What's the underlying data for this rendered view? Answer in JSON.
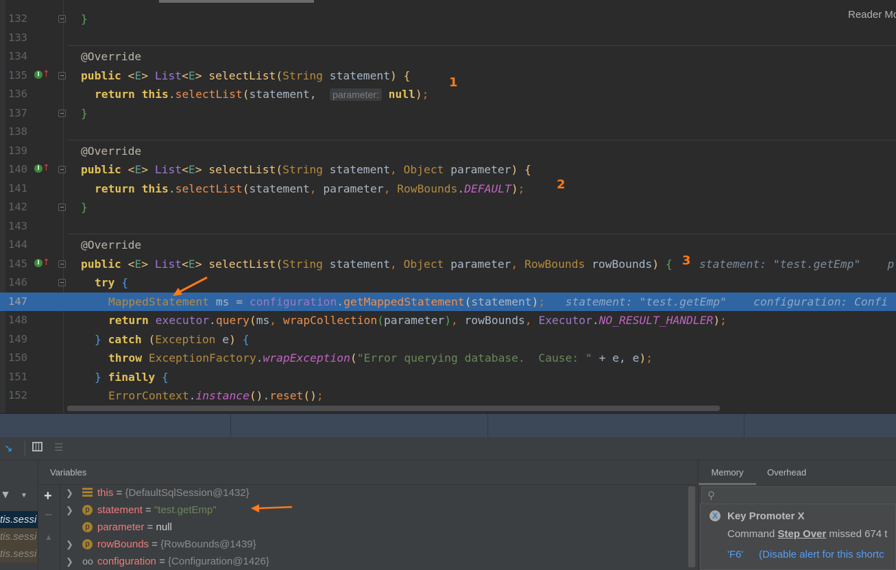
{
  "editor": {
    "reader_mode": "Reader Mode",
    "annotations": [
      "1",
      "2",
      "3"
    ],
    "lines": [
      {
        "n": "132",
        "indent": 0,
        "tokens": [
          [
            "}",
            "br"
          ]
        ]
      },
      {
        "n": "133",
        "indent": 0,
        "tokens": []
      },
      {
        "n": "134",
        "indent": 0,
        "tokens": [
          [
            "@Override",
            "ann"
          ]
        ]
      },
      {
        "n": "135",
        "indent": 0,
        "gutter": true,
        "tokens": [
          [
            "public ",
            "kw"
          ],
          [
            "<",
            "mt"
          ],
          [
            "E",
            "gen"
          ],
          [
            "> ",
            "mt"
          ],
          [
            "List",
            "lst"
          ],
          [
            "<",
            "mt"
          ],
          [
            "E",
            "gen"
          ],
          [
            "> ",
            "mt"
          ],
          [
            "selectList",
            "mt"
          ],
          [
            "(",
            "mt"
          ],
          [
            "String ",
            "ty"
          ],
          [
            "statement",
            "nm"
          ],
          [
            ") ",
            "mt"
          ],
          [
            "{",
            "mt"
          ]
        ]
      },
      {
        "n": "136",
        "indent": 1,
        "tokens": [
          [
            "return ",
            "kw"
          ],
          [
            "this",
            "kw"
          ],
          [
            ".",
            "nm"
          ],
          [
            "selectList",
            "mo"
          ],
          [
            "(",
            "mt"
          ],
          [
            "statement, ",
            "nm"
          ],
          [
            "hint:parameter:",
            "hint"
          ],
          [
            " null",
            "kw"
          ],
          [
            ")",
            "mt"
          ],
          [
            ";",
            "pu"
          ]
        ]
      },
      {
        "n": "137",
        "indent": 0,
        "tokens": [
          [
            "}",
            "br"
          ]
        ]
      },
      {
        "n": "138",
        "indent": 0,
        "tokens": []
      },
      {
        "n": "139",
        "indent": 0,
        "tokens": [
          [
            "@Override",
            "ann"
          ]
        ]
      },
      {
        "n": "140",
        "indent": 0,
        "gutter": true,
        "tokens": [
          [
            "public ",
            "kw"
          ],
          [
            "<",
            "mt"
          ],
          [
            "E",
            "gen"
          ],
          [
            "> ",
            "mt"
          ],
          [
            "List",
            "lst"
          ],
          [
            "<",
            "mt"
          ],
          [
            "E",
            "gen"
          ],
          [
            "> ",
            "mt"
          ],
          [
            "selectList",
            "mt"
          ],
          [
            "(",
            "mt"
          ],
          [
            "String ",
            "ty"
          ],
          [
            "statement",
            "nm"
          ],
          [
            ", ",
            "pu"
          ],
          [
            "Object ",
            "ty"
          ],
          [
            "parameter",
            "nm"
          ],
          [
            ") ",
            "mt"
          ],
          [
            "{",
            "mt"
          ]
        ]
      },
      {
        "n": "141",
        "indent": 1,
        "tokens": [
          [
            "return ",
            "kw"
          ],
          [
            "this",
            "kw"
          ],
          [
            ".",
            "nm"
          ],
          [
            "selectList",
            "mo"
          ],
          [
            "(",
            "mt"
          ],
          [
            "statement",
            "nm"
          ],
          [
            ", ",
            "pu"
          ],
          [
            "parameter",
            "nm"
          ],
          [
            ", ",
            "pu"
          ],
          [
            "RowBounds",
            "ty"
          ],
          [
            ".",
            "nm"
          ],
          [
            "DEFAULT",
            "it"
          ],
          [
            ")",
            "mt"
          ],
          [
            ";",
            "pu"
          ]
        ]
      },
      {
        "n": "142",
        "indent": 0,
        "tokens": [
          [
            "}",
            "br"
          ]
        ]
      },
      {
        "n": "143",
        "indent": 0,
        "tokens": []
      },
      {
        "n": "144",
        "indent": 0,
        "tokens": [
          [
            "@Override",
            "ann"
          ]
        ]
      },
      {
        "n": "145",
        "indent": 0,
        "gutter": true,
        "tokens": [
          [
            "public ",
            "kw"
          ],
          [
            "<",
            "mt"
          ],
          [
            "E",
            "gen"
          ],
          [
            "> ",
            "mt"
          ],
          [
            "List",
            "lst"
          ],
          [
            "<",
            "mt"
          ],
          [
            "E",
            "gen"
          ],
          [
            "> ",
            "mt"
          ],
          [
            "selectList",
            "mt"
          ],
          [
            "(",
            "mt"
          ],
          [
            "String ",
            "ty"
          ],
          [
            "statement",
            "nm"
          ],
          [
            ", ",
            "pu"
          ],
          [
            "Object ",
            "ty"
          ],
          [
            "parameter",
            "nm"
          ],
          [
            ", ",
            "pu"
          ],
          [
            "RowBounds ",
            "ty"
          ],
          [
            "rowBounds",
            "nm"
          ],
          [
            ") ",
            "mt"
          ],
          [
            "{",
            "br"
          ],
          [
            "    statement: \"test.getEmp\"    p",
            "dbg"
          ]
        ]
      },
      {
        "n": "146",
        "indent": 1,
        "tokens": [
          [
            "try ",
            "kw"
          ],
          [
            "{",
            "bb"
          ]
        ]
      },
      {
        "n": "147",
        "indent": 2,
        "current": true,
        "tokens": [
          [
            "MappedStatement ",
            "ty"
          ],
          [
            "ms = ",
            "nm"
          ],
          [
            "configuration",
            "fld"
          ],
          [
            ".",
            "nm"
          ],
          [
            "getMappedStatement",
            "mo"
          ],
          [
            "(",
            "mt"
          ],
          [
            "statement",
            "nm"
          ],
          [
            ")",
            "mt"
          ],
          [
            ";",
            "pu"
          ],
          [
            "   statement: \"test.getEmp\"    configuration: Confi",
            "dbg"
          ]
        ]
      },
      {
        "n": "148",
        "indent": 2,
        "tokens": [
          [
            "return ",
            "kw"
          ],
          [
            "executor",
            "fld"
          ],
          [
            ".",
            "nm"
          ],
          [
            "query",
            "mo"
          ],
          [
            "(",
            "mt"
          ],
          [
            "ms",
            "nm"
          ],
          [
            ", ",
            "pu"
          ],
          [
            "wrapCollection",
            "mo"
          ],
          [
            "(",
            "br"
          ],
          [
            "parameter",
            "nm"
          ],
          [
            ")",
            "br"
          ],
          [
            ", ",
            "pu"
          ],
          [
            "rowBounds",
            "nm"
          ],
          [
            ", ",
            "pu"
          ],
          [
            "Executor",
            "fld"
          ],
          [
            ".",
            "nm"
          ],
          [
            "NO_RESULT_HANDLER",
            "it"
          ],
          [
            ")",
            "mt"
          ],
          [
            ";",
            "pu"
          ]
        ]
      },
      {
        "n": "149",
        "indent": 1,
        "tokens": [
          [
            "} ",
            "bb"
          ],
          [
            "catch ",
            "kw"
          ],
          [
            "(",
            "mt"
          ],
          [
            "Exception ",
            "ty"
          ],
          [
            "e",
            "nm"
          ],
          [
            ") ",
            "mt"
          ],
          [
            "{",
            "bb"
          ]
        ]
      },
      {
        "n": "150",
        "indent": 2,
        "tokens": [
          [
            "throw ",
            "kw"
          ],
          [
            "ExceptionFactory",
            "ty"
          ],
          [
            ".",
            "nm"
          ],
          [
            "wrapException",
            "it"
          ],
          [
            "(",
            "mt"
          ],
          [
            "\"Error querying database.  Cause: \"",
            "st"
          ],
          [
            " + e, e",
            "nm"
          ],
          [
            ")",
            "mt"
          ],
          [
            ";",
            "pu"
          ]
        ]
      },
      {
        "n": "151",
        "indent": 1,
        "tokens": [
          [
            "} ",
            "bb"
          ],
          [
            "finally ",
            "kw"
          ],
          [
            "{",
            "bb"
          ]
        ]
      },
      {
        "n": "152",
        "indent": 2,
        "tokens": [
          [
            "ErrorContext",
            "ty"
          ],
          [
            ".",
            "nm"
          ],
          [
            "instance",
            "it"
          ],
          [
            "()",
            "mt"
          ],
          [
            ".",
            "nm"
          ],
          [
            "reset",
            "mo"
          ],
          [
            "()",
            "mt"
          ],
          [
            ";",
            "pu"
          ]
        ]
      }
    ]
  },
  "debugger": {
    "variables_title": "Variables",
    "frames": [
      "tis.sessi",
      "tis.sessi",
      "tis.sessi"
    ],
    "variables": [
      {
        "name": "this",
        "value": "{DefaultSqlSession@1432}",
        "icon": "field-list-icon",
        "expandable": true,
        "kind": "obj"
      },
      {
        "name": "statement",
        "value": "\"test.getEmp\"",
        "icon": "p",
        "expandable": true,
        "kind": "str"
      },
      {
        "name": "parameter",
        "value": "null",
        "icon": "p",
        "expandable": false,
        "kind": "null"
      },
      {
        "name": "rowBounds",
        "value": "{RowBounds@1439}",
        "icon": "p",
        "expandable": true,
        "kind": "obj"
      },
      {
        "name": "configuration",
        "value": "{Configuration@1426}",
        "icon": "watch-glasses-icon",
        "expandable": true,
        "kind": "obj"
      }
    ],
    "right_tabs": [
      "Memory",
      "Overhead"
    ],
    "active_right_tab": "Memory"
  },
  "key_promoter": {
    "title": "Key Promoter X",
    "command_prefix": "Command ",
    "command": "Step Over",
    "command_suffix": " missed 674 t",
    "shortcut": "'F6'",
    "disable": "(Disable alert for this shortc"
  },
  "colors": {
    "accent_arrow": "#ff7a1a",
    "current_line": "#2f65a3",
    "link": "#589df6"
  }
}
